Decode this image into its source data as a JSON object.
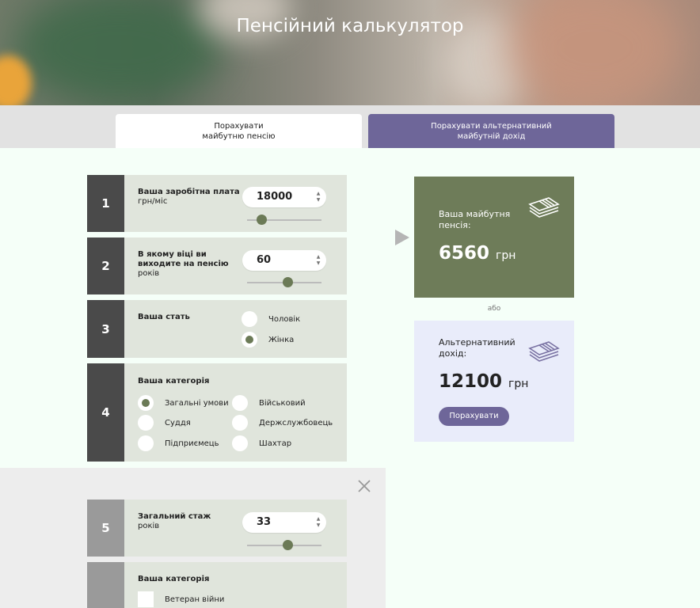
{
  "header": {
    "title": "Пенсійний калькулятор"
  },
  "tabs": [
    {
      "line1": "Порахувати",
      "line2": "майбутню пенсію"
    },
    {
      "line1": "Порахувати альтернативний",
      "line2": "майбутній дохід"
    }
  ],
  "step1": {
    "number": "1",
    "label": "Ваша заробітна плата",
    "unit": "грн/міс",
    "value": "18000",
    "slider_fraction": 0.2
  },
  "step2": {
    "number": "2",
    "label": "В якому віці ви виходите на пенсію",
    "unit": "років",
    "value": "60",
    "slider_fraction": 0.55
  },
  "step3": {
    "number": "3",
    "label": "Ваша стать",
    "options": [
      "Чоловік",
      "Жінка"
    ],
    "selected": "Жінка"
  },
  "step4": {
    "number": "4",
    "label": "Ваша категорія",
    "options": [
      "Загальні умови",
      "Військовий",
      "Суддя",
      "Держслужбовець",
      "Підприємець",
      "Шахтар"
    ],
    "selected": "Загальні умови"
  },
  "step5": {
    "number": "5",
    "label": "Загальний стаж",
    "unit": "років",
    "value": "33",
    "slider_fraction": 0.55
  },
  "step6": {
    "label": "Ваша категорія",
    "options": [
      "Ветеран війни"
    ]
  },
  "result_pension": {
    "title_line1": "Ваша майбутня",
    "title_line2": "пенсія:",
    "value": "6560",
    "unit": "грн",
    "icon": "money-stack-icon"
  },
  "or_text": "або",
  "result_alt": {
    "title_line1": "Альтернативний",
    "title_line2": "дохід:",
    "value": "12100",
    "unit": "грн",
    "button": "Порахувати",
    "icon": "money-stack-icon"
  },
  "colors": {
    "accent_green": "#6e7c59",
    "accent_purple": "#6e6699",
    "panel": "#e0e5dc",
    "step_dark": "#4a4a4a"
  }
}
